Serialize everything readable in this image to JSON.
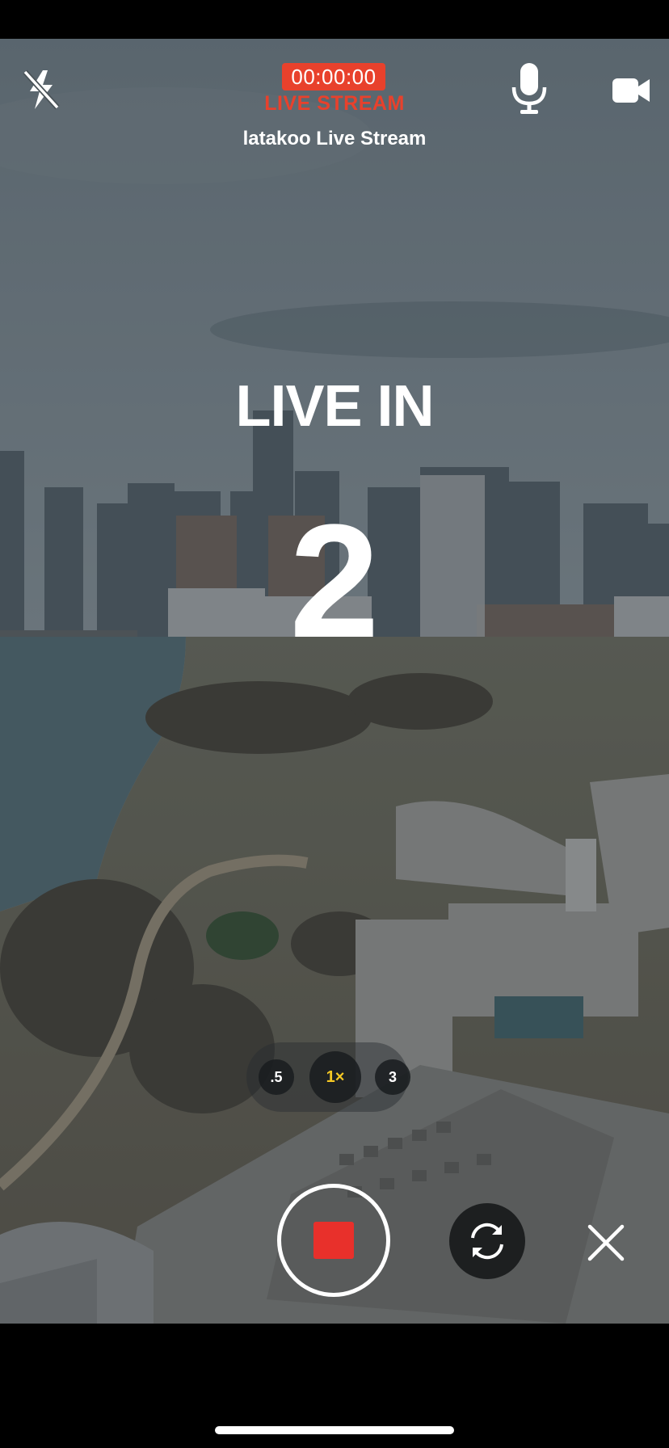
{
  "header": {
    "timer": "00:00:00",
    "live_label": "LIVE STREAM",
    "stream_name": "latakoo Live Stream"
  },
  "countdown": {
    "title": "LIVE IN",
    "number": "2"
  },
  "zoom": {
    "options": [
      ".5",
      "1×",
      "3"
    ],
    "selected": "1×"
  },
  "icons": {
    "flash": "flash-off-icon",
    "mic": "microphone-icon",
    "camera": "video-camera-icon",
    "switch": "switch-camera-icon",
    "close": "close-icon"
  },
  "colors": {
    "live_red": "#e8412c",
    "record_red": "#e8302b",
    "zoom_selected": "#f5c824"
  }
}
